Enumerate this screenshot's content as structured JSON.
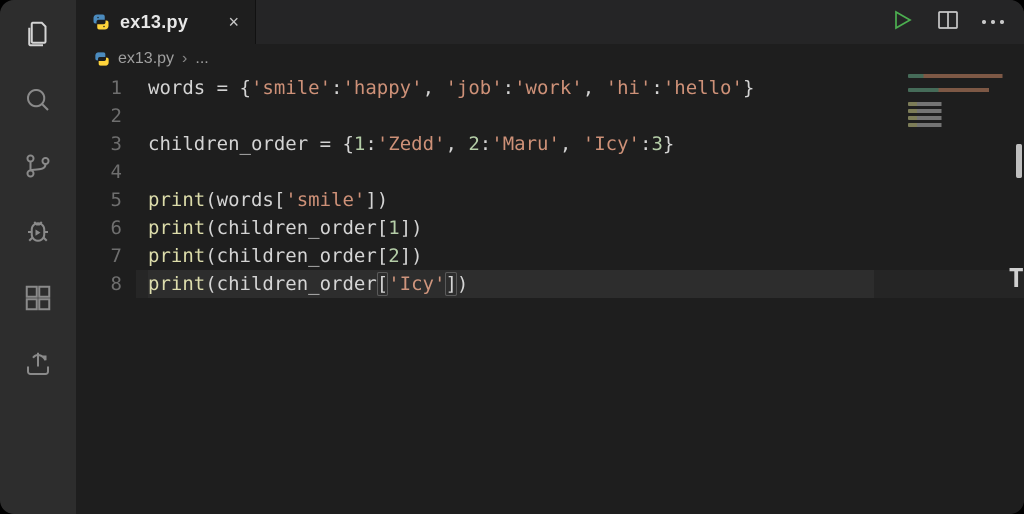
{
  "tab": {
    "filename": "ex13.py",
    "close_glyph": "×"
  },
  "breadcrumb": {
    "filename": "ex13.py",
    "separator": "›",
    "tail": "..."
  },
  "toolbar": {
    "run": "Run",
    "split": "Split Editor",
    "more": "More Actions"
  },
  "activity": {
    "explorer": "Explorer",
    "search": "Search",
    "scm": "Source Control",
    "debug": "Run and Debug",
    "extensions": "Extensions",
    "share": "Live Share"
  },
  "code": {
    "line_numbers": [
      "1",
      "2",
      "3",
      "4",
      "5",
      "6",
      "7",
      "8"
    ],
    "lines": [
      [
        {
          "t": "words = {",
          "c": "tk-plain"
        },
        {
          "t": "'smile'",
          "c": "tk-str"
        },
        {
          "t": ":",
          "c": "tk-plain"
        },
        {
          "t": "'happy'",
          "c": "tk-str"
        },
        {
          "t": ", ",
          "c": "tk-plain"
        },
        {
          "t": "'job'",
          "c": "tk-str"
        },
        {
          "t": ":",
          "c": "tk-plain"
        },
        {
          "t": "'work'",
          "c": "tk-str"
        },
        {
          "t": ", ",
          "c": "tk-plain"
        },
        {
          "t": "'hi'",
          "c": "tk-str"
        },
        {
          "t": ":",
          "c": "tk-plain"
        },
        {
          "t": "'hello'",
          "c": "tk-str"
        },
        {
          "t": "}",
          "c": "tk-plain"
        }
      ],
      [],
      [
        {
          "t": "children_order = {",
          "c": "tk-plain"
        },
        {
          "t": "1",
          "c": "tk-num"
        },
        {
          "t": ":",
          "c": "tk-plain"
        },
        {
          "t": "'Zedd'",
          "c": "tk-str"
        },
        {
          "t": ", ",
          "c": "tk-plain"
        },
        {
          "t": "2",
          "c": "tk-num"
        },
        {
          "t": ":",
          "c": "tk-plain"
        },
        {
          "t": "'Maru'",
          "c": "tk-str"
        },
        {
          "t": ", ",
          "c": "tk-plain"
        },
        {
          "t": "'Icy'",
          "c": "tk-str"
        },
        {
          "t": ":",
          "c": "tk-plain"
        },
        {
          "t": "3",
          "c": "tk-num"
        },
        {
          "t": "}",
          "c": "tk-plain"
        }
      ],
      [],
      [
        {
          "t": "print",
          "c": "tk-func"
        },
        {
          "t": "(words[",
          "c": "tk-plain"
        },
        {
          "t": "'smile'",
          "c": "tk-str"
        },
        {
          "t": "])",
          "c": "tk-plain"
        }
      ],
      [
        {
          "t": "print",
          "c": "tk-func"
        },
        {
          "t": "(children_order[",
          "c": "tk-plain"
        },
        {
          "t": "1",
          "c": "tk-num"
        },
        {
          "t": "])",
          "c": "tk-plain"
        }
      ],
      [
        {
          "t": "print",
          "c": "tk-func"
        },
        {
          "t": "(children_order[",
          "c": "tk-plain"
        },
        {
          "t": "2",
          "c": "tk-num"
        },
        {
          "t": "])",
          "c": "tk-plain"
        }
      ],
      [
        {
          "t": "print",
          "c": "tk-func"
        },
        {
          "t": "(children_order[",
          "c": "tk-plain"
        },
        {
          "t": "'Icy'",
          "c": "tk-str"
        },
        {
          "t": "])",
          "c": "tk-plain"
        }
      ]
    ],
    "current_line_index": 7
  }
}
